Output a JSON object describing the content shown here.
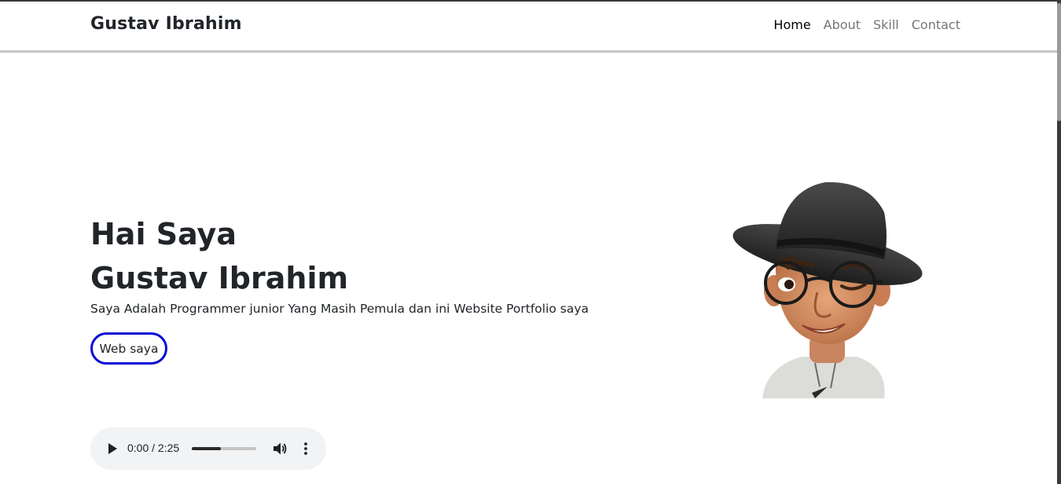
{
  "navbar": {
    "brand": "Gustav Ibrahim",
    "links": [
      {
        "label": "Home",
        "active": true
      },
      {
        "label": "About",
        "active": false
      },
      {
        "label": "Skill",
        "active": false
      },
      {
        "label": "Contact",
        "active": false
      }
    ]
  },
  "hero": {
    "title_line1": "Hai Saya",
    "title_line2": "Gustav Ibrahim",
    "description": "Saya Adalah Programmer junior Yang Masih Pemula dan ini Website Portfolio saya",
    "button_label": "Web saya",
    "button_border_color": "#0a0ad6",
    "avatar_icon": "memoji-avatar-with-hat-and-glasses"
  },
  "audio_player": {
    "time_display": "0:00 / 2:25",
    "progress_fraction": 0.45,
    "play_icon": "play-icon",
    "volume_icon": "volume-icon",
    "more_icon": "more-vertical-icon"
  }
}
